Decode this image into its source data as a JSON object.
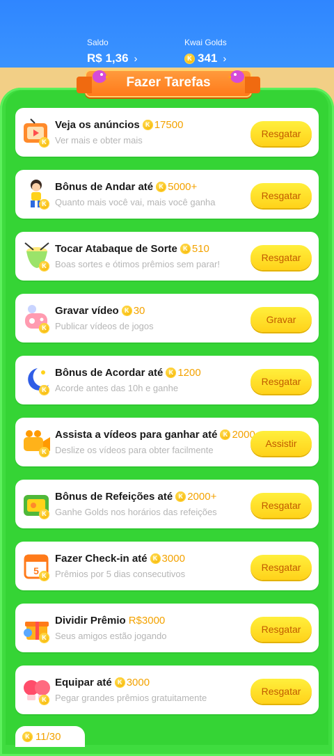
{
  "header": {
    "saldo_label": "Saldo",
    "saldo_value": "R$ 1,36",
    "golds_label": "Kwai Golds",
    "golds_value": "341",
    "chevron": "›"
  },
  "banner": {
    "title": "Fazer Tarefas"
  },
  "tasks": [
    {
      "title": "Veja os anúncios",
      "reward": "17500",
      "subtitle": "Ver mais e obter mais",
      "button": "Resgatar",
      "icon": "tv-icon"
    },
    {
      "title": "Bônus de Andar até",
      "reward": "5000+",
      "subtitle": "Quanto mais você vai, mais você ganha",
      "button": "Resgatar",
      "icon": "walking-boy-icon"
    },
    {
      "title": "Tocar Atabaque de Sorte",
      "reward": "510",
      "subtitle": "Boas sortes e ótimos prêmios sem parar!",
      "button": "Resgatar",
      "icon": "drum-icon"
    },
    {
      "title": "Gravar vídeo",
      "reward": "30",
      "subtitle": "Publicar vídeos de jogos",
      "button": "Gravar",
      "icon": "gamepad-icon"
    },
    {
      "title": "Bônus de Acordar até",
      "reward": "1200",
      "subtitle": "Acorde antes das 10h e ganhe",
      "button": "Resgatar",
      "icon": "moon-icon"
    },
    {
      "title": "Assista a vídeos para ganhar até",
      "reward": "2000",
      "subtitle": "Deslize os vídeos para obter facilmente",
      "button": "Assistir",
      "icon": "camera-icon"
    },
    {
      "title": "Bônus de Refeições até",
      "reward": "2000+",
      "subtitle": "Ganhe Golds nos horários das refeições",
      "button": "Resgatar",
      "icon": "lunchbox-icon"
    },
    {
      "title": "Fazer Check-in até",
      "reward": "3000",
      "subtitle": "Prêmios por 5 dias consecutivos",
      "button": "Resgatar",
      "icon": "calendar-icon"
    },
    {
      "title": "Dividir Prêmio",
      "reward": "R$3000",
      "subtitle": "Seus amigos estão jogando",
      "button": "Resgatar",
      "icon": "gift-icon"
    },
    {
      "title": "Equipar até",
      "reward": "3000",
      "subtitle": "Pegar grandes prêmios gratuitamente",
      "button": "Resgatar",
      "icon": "boxing-gloves-icon"
    }
  ],
  "footer": {
    "progress": "11/30"
  }
}
